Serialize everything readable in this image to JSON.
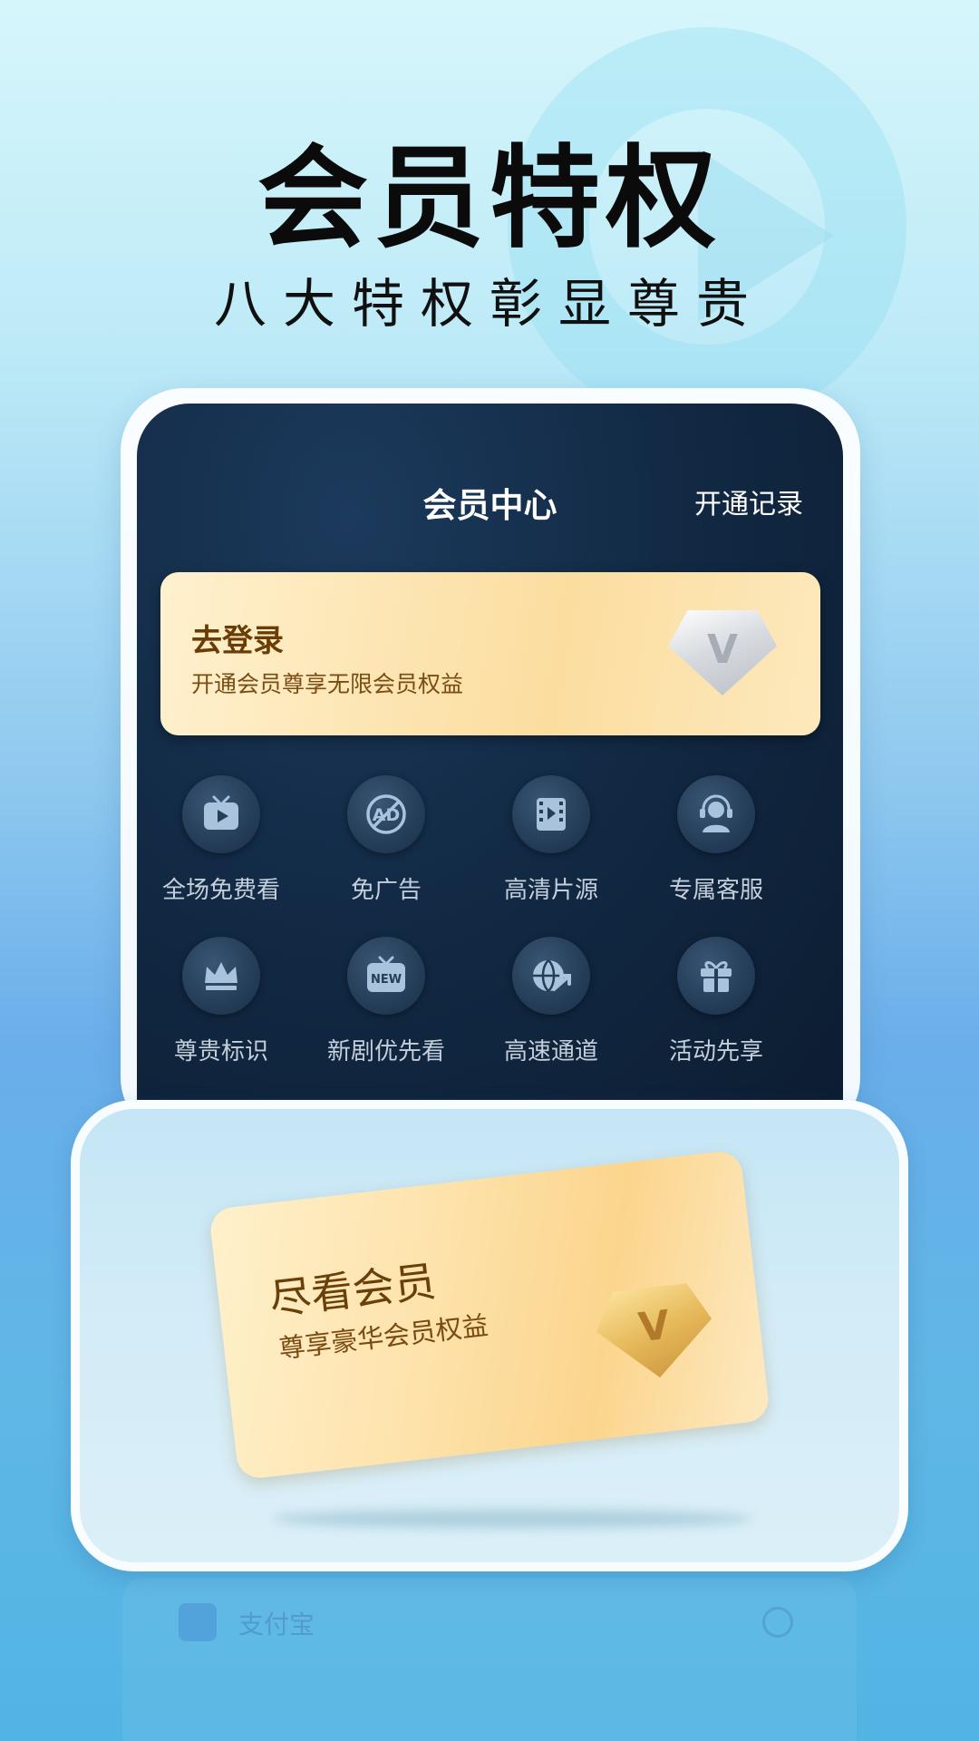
{
  "hero": {
    "title": "会员特权",
    "subtitle": "八大特权彰显尊贵"
  },
  "member_center": {
    "title": "会员中心",
    "record_link": "开通记录",
    "login_card": {
      "title": "去登录",
      "subtitle": "开通会员尊享无限会员权益",
      "badge_letter": "V"
    },
    "features": [
      {
        "label": "全场免费看",
        "icon": "tv-play-icon"
      },
      {
        "label": "免广告",
        "icon": "no-ad-icon"
      },
      {
        "label": "高清片源",
        "icon": "film-icon"
      },
      {
        "label": "专属客服",
        "icon": "customer-service-icon"
      },
      {
        "label": "尊贵标识",
        "icon": "crown-icon"
      },
      {
        "label": "新剧优先看",
        "icon": "new-tv-icon"
      },
      {
        "label": "高速通道",
        "icon": "globe-speed-icon"
      },
      {
        "label": "活动先享",
        "icon": "gift-icon"
      }
    ]
  },
  "vip_card": {
    "title": "尽看会员",
    "subtitle": "尊享豪华会员权益",
    "badge_letter": "V"
  },
  "payment": {
    "option_label": "支付宝"
  },
  "colors": {
    "gold": "#fbdd9f",
    "dark_panel": "#122a45",
    "icon_fill": "#a9c3dc"
  }
}
